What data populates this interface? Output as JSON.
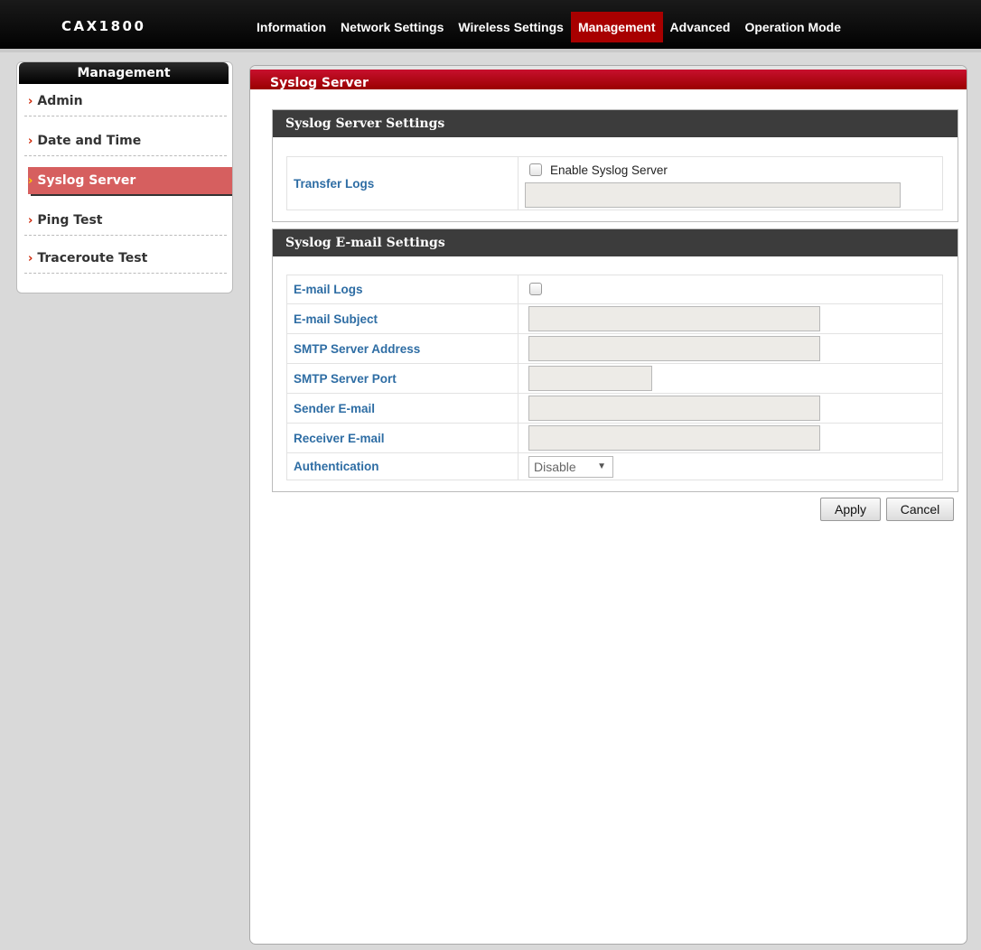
{
  "brand": "CAX1800",
  "nav": {
    "items": [
      {
        "label": "Information"
      },
      {
        "label": "Network Settings"
      },
      {
        "label": "Wireless Settings"
      },
      {
        "label": "Management"
      },
      {
        "label": "Advanced"
      },
      {
        "label": "Operation Mode"
      }
    ],
    "active": "Management"
  },
  "sidebar": {
    "title": "Management",
    "items": [
      {
        "label": "Admin"
      },
      {
        "label": "Date and Time"
      },
      {
        "label": "Syslog Server"
      },
      {
        "label": "Ping Test"
      },
      {
        "label": "Traceroute Test"
      }
    ],
    "active": "Syslog Server",
    "chevron": "›"
  },
  "page": {
    "title": "Syslog Server"
  },
  "syslog_server_settings": {
    "title": "Syslog Server Settings",
    "transfer_logs_label": "Transfer Logs",
    "enable_label": "Enable Syslog Server",
    "enable_checked": false,
    "server_value": ""
  },
  "email_settings": {
    "title": "Syslog E-mail Settings",
    "email_logs_label": "E-mail Logs",
    "email_logs_checked": false,
    "email_subject_label": "E-mail Subject",
    "email_subject_value": "",
    "smtp_address_label": "SMTP Server Address",
    "smtp_address_value": "",
    "smtp_port_label": "SMTP Server Port",
    "smtp_port_value": "",
    "sender_label": "Sender E-mail",
    "sender_value": "",
    "receiver_label": "Receiver E-mail",
    "receiver_value": "",
    "auth_label": "Authentication",
    "auth_value": "Disable",
    "auth_arrow": "▼"
  },
  "buttons": {
    "apply": "Apply",
    "cancel": "Cancel"
  }
}
